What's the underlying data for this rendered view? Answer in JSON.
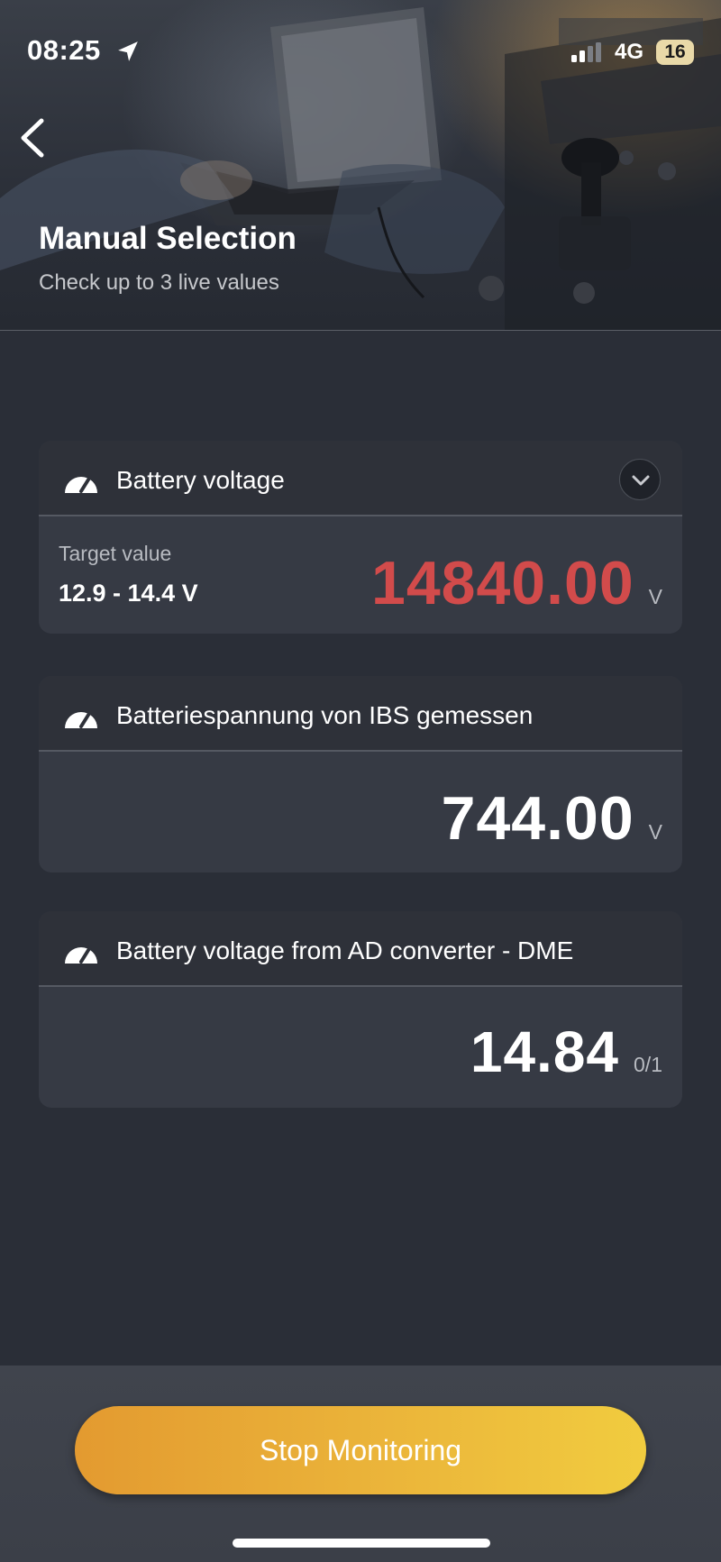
{
  "status_bar": {
    "time": "08:25",
    "network": "4G",
    "battery": "16",
    "icons": [
      "location-arrow-icon",
      "signal-bars-icon"
    ]
  },
  "header": {
    "title": "Manual Selection",
    "subtitle": "Check up to 3 live values"
  },
  "cards": [
    {
      "title": "Battery voltage",
      "target_label": "Target value",
      "target_range": "12.9 - 14.4 V",
      "value": "14840.00",
      "unit": "V",
      "value_color": "#d24b4b",
      "expandable": true
    },
    {
      "title": "Batteriespannung von IBS gemessen",
      "value": "744.00",
      "unit": "V"
    },
    {
      "title": "Battery voltage from AD converter - DME",
      "value": "14.84",
      "unit": "0/1"
    }
  ],
  "footer": {
    "stop_label": "Stop Monitoring"
  },
  "colors": {
    "accent_start": "#e39a30",
    "accent_end": "#f1cc3f",
    "alert": "#d24b4b",
    "background": "#2a2e37"
  }
}
